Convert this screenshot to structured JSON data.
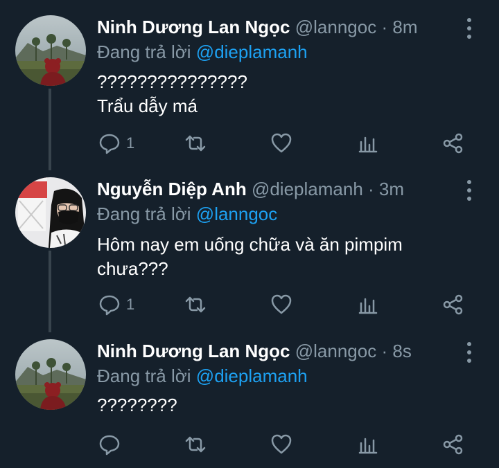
{
  "tweets": [
    {
      "name": "Ninh Dương Lan Ngọc",
      "handle": "@lanngoc",
      "dot": "·",
      "time": "8m",
      "reply_prefix": "Đang trả lời",
      "reply_to": "@dieplamanh",
      "lines": [
        "???????????????",
        "Trẩu dẫy má"
      ],
      "reply_count": "1",
      "avatar": "landscape-with-red-figure"
    },
    {
      "name": "Nguyễn Diệp Anh",
      "handle": "@dieplamanh",
      "dot": "·",
      "time": "3m",
      "reply_prefix": "Đang trả lời",
      "reply_to": "@lanngoc",
      "lines": [
        "Hôm nay em uống chữa và ăn pimpim",
        "chưa???"
      ],
      "reply_count": "1",
      "avatar": "person-with-mask"
    },
    {
      "name": "Ninh Dương Lan Ngọc",
      "handle": "@lanngoc",
      "dot": "·",
      "time": "8s",
      "reply_prefix": "Đang trả lời",
      "reply_to": "@dieplamanh",
      "lines": [
        "????????"
      ],
      "reply_count": "",
      "avatar": "landscape-with-red-figure"
    }
  ],
  "icons": {
    "reply": "reply-icon",
    "retweet": "retweet-icon",
    "like": "heart-icon",
    "views": "analytics-icon",
    "share": "share-icon",
    "more": "more-vertical-icon"
  },
  "colors": {
    "background": "#15202b",
    "muted": "#8899a6",
    "link": "#1da1f2",
    "thread_line": "#38444d"
  }
}
